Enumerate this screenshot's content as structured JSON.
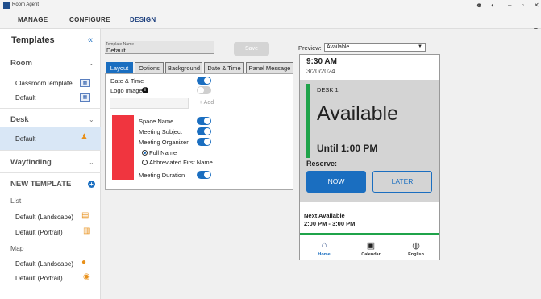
{
  "app": {
    "title": "Room Agent"
  },
  "nav": {
    "tabs": [
      "MANAGE",
      "CONFIGURE",
      "DESIGN"
    ],
    "active": "DESIGN"
  },
  "sidebar": {
    "heading": "Templates",
    "sections": {
      "room": {
        "title": "Room",
        "items": [
          "ClassroomTemplate",
          "Default"
        ]
      },
      "desk": {
        "title": "Desk",
        "items": [
          "Default"
        ]
      },
      "wayfinding": {
        "title": "Wayfinding"
      },
      "new_template": {
        "title": "NEW TEMPLATE"
      },
      "list": {
        "title": "List",
        "items": [
          "Default (Landscape)",
          "Default (Portrait)"
        ]
      },
      "map": {
        "title": "Map",
        "items": [
          "Default (Landscape)",
          "Default (Portrait)"
        ]
      }
    }
  },
  "editor": {
    "template_name_label": "Template Name",
    "template_name_value": "Default",
    "save_label": "Save",
    "tabs": [
      "Layout",
      "Options",
      "Background",
      "Date & Time",
      "Panel Message"
    ],
    "active_tab": "Layout",
    "options": {
      "date_time": {
        "label": "Date & Time",
        "on": true
      },
      "logo_image": {
        "label": "Logo Image",
        "on": false
      },
      "add_label": "+ Add",
      "space_name": {
        "label": "Space Name",
        "on": true
      },
      "meeting_subject": {
        "label": "Meeting Subject",
        "on": true
      },
      "meeting_organizer": {
        "label": "Meeting Organizer",
        "on": true
      },
      "organizer_formats": [
        "Full Name",
        "Abbreviated First Name"
      ],
      "organizer_selected": "Full Name",
      "meeting_duration": {
        "label": "Meeting Duration",
        "on": true
      }
    },
    "accent_color": "#f0353f"
  },
  "preview": {
    "label": "Preview:",
    "selected": "Available",
    "time": "9:30 AM",
    "date": "3/20/2024",
    "desk_name": "DESK 1",
    "status": "Available",
    "until": "Until 1:00 PM",
    "reserve_label": "Reserve:",
    "now_label": "NOW",
    "later_label": "LATER",
    "next_label": "Next Available",
    "next_time": "2:00 PM - 3:00 PM",
    "bottom_nav": [
      {
        "label": "Home",
        "icon": "home-icon"
      },
      {
        "label": "Calendar",
        "icon": "calendar-icon"
      },
      {
        "label": "English",
        "icon": "globe-icon"
      }
    ],
    "status_color": "#1fa34a",
    "primary_color": "#1a6ec0"
  }
}
